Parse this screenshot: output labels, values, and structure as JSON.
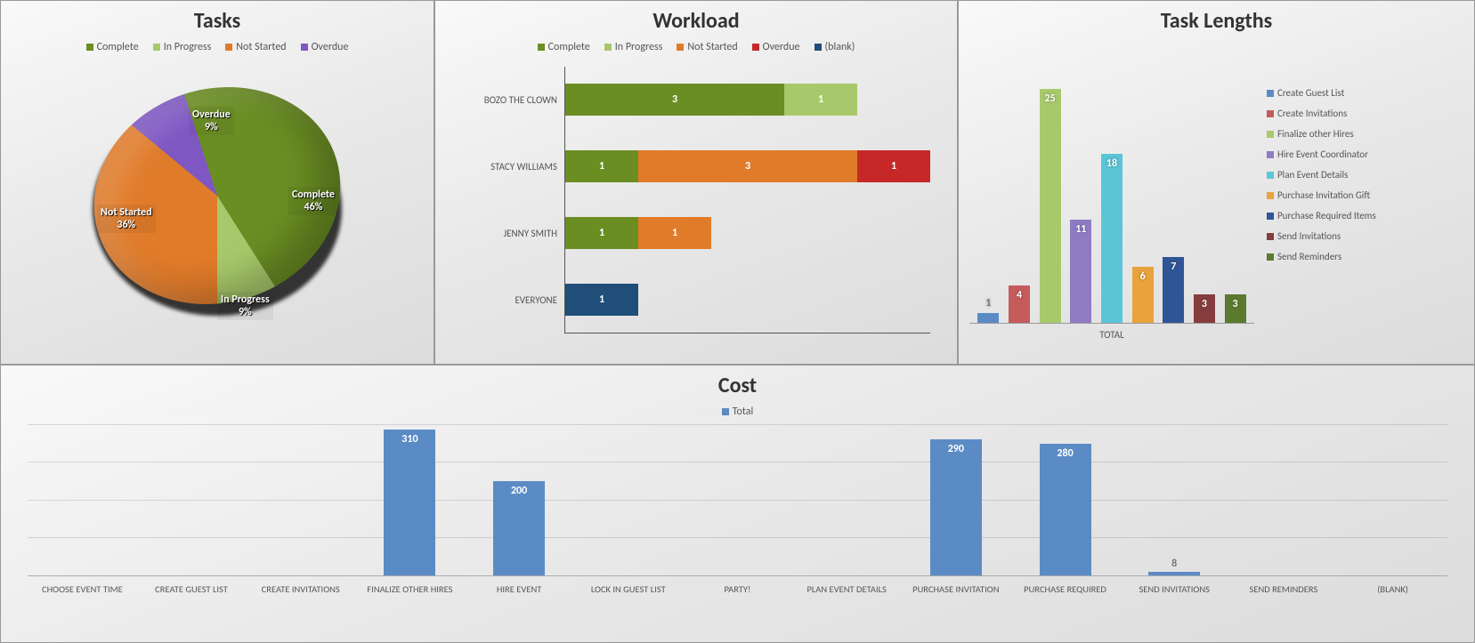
{
  "chart_data": [
    {
      "id": "tasks",
      "type": "pie",
      "title": "Tasks",
      "series": [
        {
          "name": "Complete",
          "value": 46,
          "label": "46%",
          "color": "#6b8e23"
        },
        {
          "name": "In Progress",
          "value": 9,
          "label": "9%",
          "color": "#a8c96b"
        },
        {
          "name": "Not Started",
          "value": 36,
          "label": "36%",
          "color": "#e07b2a"
        },
        {
          "name": "Overdue",
          "value": 9,
          "label": "9%",
          "color": "#7e57c2"
        }
      ],
      "legend": [
        "Complete",
        "In Progress",
        "Not Started",
        "Overdue"
      ]
    },
    {
      "id": "workload",
      "type": "bar",
      "orientation": "horizontal",
      "stacked": true,
      "title": "Workload",
      "legend": [
        "Complete",
        "In Progress",
        "Not Started",
        "Overdue",
        "(blank)"
      ],
      "legend_colors": [
        "#6b8e23",
        "#a8c96b",
        "#e07b2a",
        "#c62828",
        "#1f4e79"
      ],
      "categories": [
        "BOZO THE CLOWN",
        "STACY WILLIAMS",
        "JENNY SMITH",
        "EVERYONE"
      ],
      "xmax": 5,
      "series": [
        {
          "name": "Complete",
          "values": [
            3,
            1,
            1,
            0
          ]
        },
        {
          "name": "In Progress",
          "values": [
            1,
            0,
            0,
            0
          ]
        },
        {
          "name": "Not Started",
          "values": [
            0,
            3,
            1,
            0
          ]
        },
        {
          "name": "Overdue",
          "values": [
            0,
            1,
            0,
            0
          ]
        },
        {
          "name": "(blank)",
          "values": [
            0,
            0,
            0,
            1
          ]
        }
      ]
    },
    {
      "id": "task_lengths",
      "type": "bar",
      "title": "Task Lengths",
      "xlabel": "TOTAL",
      "ymax": 28,
      "categories": [
        "Create Guest List",
        "Create Invitations",
        "Finalize other Hires",
        "Hire Event Coordinator",
        "Plan Event Details",
        "Purchase Invitation Gift",
        "Purchase Required Items",
        "Send Invitations",
        "Send Reminders"
      ],
      "colors": [
        "#5b8bc5",
        "#c55b5b",
        "#a8c96b",
        "#8e7cc3",
        "#5bc5d8",
        "#e8a33d",
        "#2f5597",
        "#843c3c",
        "#5b7a2e"
      ],
      "values": [
        1,
        4,
        25,
        11,
        18,
        6,
        7,
        3,
        3
      ]
    },
    {
      "id": "cost",
      "type": "bar",
      "title": "Cost",
      "legend": [
        "Total"
      ],
      "ymax": 320,
      "categories": [
        "CHOOSE EVENT TIME",
        "CREATE GUEST LIST",
        "CREATE INVITATIONS",
        "FINALIZE OTHER HIRES",
        "HIRE EVENT",
        "LOCK IN GUEST LIST",
        "PARTY!",
        "PLAN EVENT DETAILS",
        "PURCHASE INVITATION",
        "PURCHASE REQUIRED",
        "SEND INVITATIONS",
        "SEND REMINDERS",
        "(BLANK)"
      ],
      "values": [
        0,
        0,
        0,
        310,
        200,
        0,
        0,
        0,
        290,
        280,
        8,
        0,
        0
      ]
    }
  ],
  "titles": {
    "tasks": "Tasks",
    "workload": "Workload",
    "task_lengths": "Task Lengths",
    "cost": "Cost"
  }
}
